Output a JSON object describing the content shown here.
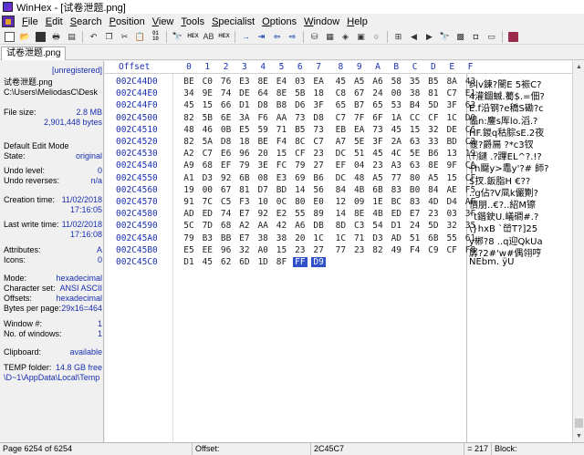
{
  "window": {
    "title": "WinHex - [试卷泄题.png]"
  },
  "menu": [
    {
      "label": "File",
      "ul": "F",
      "rest": "ile"
    },
    {
      "label": "Edit",
      "ul": "E",
      "rest": "dit"
    },
    {
      "label": "Search",
      "ul": "S",
      "rest": "earch"
    },
    {
      "label": "Position",
      "ul": "P",
      "rest": "osition"
    },
    {
      "label": "View",
      "ul": "V",
      "rest": "iew"
    },
    {
      "label": "Tools",
      "ul": "T",
      "rest": "ools"
    },
    {
      "label": "Specialist",
      "ul": "S",
      "rest": "pecialist"
    },
    {
      "label": "Options",
      "ul": "O",
      "rest": "ptions"
    },
    {
      "label": "Window",
      "ul": "W",
      "rest": "indow"
    },
    {
      "label": "Help",
      "ul": "H",
      "rest": "elp"
    }
  ],
  "toolbar": [
    "new-file-icon",
    "open-file-icon",
    "save-icon",
    "print-icon",
    "properties-icon",
    "sep",
    "undo-icon",
    "copy-block-icon",
    "cut-icon",
    "paste-icon",
    "fill-icon",
    "sep",
    "find-text-icon",
    "find-hex-icon",
    "replace-text-icon",
    "replace-hex-icon",
    "sep",
    "goto-offset-icon",
    "move-block-icon",
    "back-icon",
    "forward-icon",
    "sep",
    "disk-edit-icon",
    "ram-edit-icon",
    "disk-open-icon",
    "calculator-icon",
    "magnify-icon",
    "sep",
    "tile-icon",
    "nav-left-icon",
    "nav-right-icon",
    "bookmark-icon",
    "search-hash-icon",
    "camera-icon",
    "monitor-icon",
    "sep",
    "help-book-icon"
  ],
  "toolbar_tiny": {
    "hex_label": "HEX",
    "bin_label": "01\n10"
  },
  "tab": {
    "label": "试卷泄题.png"
  },
  "left_panel": {
    "registration": "[unregistered]",
    "file_name": "试卷泄题.png",
    "file_path": "C:\\Users\\MeliodasC\\Desk",
    "file_size_label": "File size:",
    "file_size_mb": "2.8 MB",
    "file_size_bytes": "2,901,448 bytes",
    "edit_mode": "Default Edit Mode",
    "state_label": "State:",
    "state_value": "original",
    "undo_level_label": "Undo level:",
    "undo_level_value": "0",
    "undo_reverses_label": "Undo reverses:",
    "undo_reverses_value": "n/a",
    "creation_time_label": "Creation time:",
    "creation_date": "11/02/2018",
    "creation_time": "17:16:05",
    "last_write_label": "Last write time:",
    "last_write_date": "11/02/2018",
    "last_write_time": "17:16:08",
    "attributes_label": "Attributes:",
    "attributes_value": "A",
    "icons_label": "Icons:",
    "icons_value": "0",
    "mode_label": "Mode:",
    "mode_value": "hexadecimal",
    "charset_label": "Character set:",
    "charset_value": "ANSI ASCII",
    "offsets_label": "Offsets:",
    "offsets_value": "hexadecimal",
    "bpp_label": "Bytes per page:",
    "bpp_value": "29x16=464",
    "window_num_label": "Window #:",
    "window_num_value": "1",
    "num_windows_label": "No. of windows:",
    "num_windows_value": "1",
    "clipboard_label": "Clipboard:",
    "clipboard_value": "available",
    "temp_label": "TEMP folder:",
    "temp_value": "14.8 GB free",
    "temp_path": "\\D~1\\AppData\\Local\\Temp"
  },
  "hex": {
    "header_offset": "Offset",
    "columns": [
      "0",
      "1",
      "2",
      "3",
      "4",
      "5",
      "6",
      "7",
      "8",
      "9",
      "A",
      "B",
      "C",
      "D",
      "E",
      "F"
    ],
    "rows": [
      {
        "offset": "002C44D0",
        "bytes": [
          "BE",
          "C0",
          "76",
          "E3",
          "8E",
          "E4",
          "03",
          "EA",
          "45",
          "A5",
          "A6",
          "58",
          "35",
          "B5",
          "8A",
          "43"
        ],
        "text": "纠v鍊?閿E  5裖C?"
      },
      {
        "offset": "002C44E0",
        "bytes": [
          "34",
          "9E",
          "74",
          "DE",
          "64",
          "8E",
          "5B",
          "18",
          "C8",
          "67",
          "24",
          "00",
          "38",
          "81",
          "C7",
          "E1"
        ],
        "text": "4灌錮蝛.薥$.=佃?"
      },
      {
        "offset": "002C44F0",
        "bytes": [
          "45",
          "15",
          "66",
          "D1",
          "D8",
          "B8",
          "D6",
          "3F",
          "65",
          "B7",
          "65",
          "53",
          "B4",
          "5D",
          "3F",
          "63"
        ],
        "text": "E.f沿钢?e穚S磡?c"
      },
      {
        "offset": "002C4500",
        "bytes": [
          "82",
          "5B",
          "6E",
          "3A",
          "F6",
          "AA",
          "73",
          "D8",
          "C7",
          "7F",
          "6F",
          "1A",
          "CC",
          "CF",
          "1C",
          "D0"
        ],
        "text": "偘n:鏖s厍lo.滔.?"
      },
      {
        "offset": "002C4510",
        "bytes": [
          "48",
          "46",
          "0B",
          "E5",
          "59",
          "71",
          "B5",
          "73",
          "EB",
          "EA",
          "73",
          "45",
          "15",
          "32",
          "DE",
          "C6"
        ],
        "text": "HF.鍐q秙腙sE.2夜"
      },
      {
        "offset": "002C4520",
        "bytes": [
          "82",
          "5A",
          "D8",
          "18",
          "BE",
          "F4",
          "8C",
          "C7",
          "A7",
          "5E",
          "3F",
          "2A",
          "63",
          "33",
          "BD",
          "C2"
        ],
        "text": "偃?爵屚  ?*c3钗"
      },
      {
        "offset": "002C4530",
        "bytes": [
          "A2",
          "C7",
          "E6",
          "96",
          "20",
          "15",
          "CF",
          "23",
          "DC",
          "51",
          "45",
          "4C",
          "5E",
          "B6",
          "13",
          "19"
        ],
        "text": "㈩鑓 .?蹕EL^?.!?"
      },
      {
        "offset": "002C4540",
        "bytes": [
          "A9",
          "68",
          "EF",
          "79",
          "3E",
          "FC",
          "79",
          "27",
          "EF",
          "04",
          "23",
          "A3",
          "63",
          "8E",
          "9F",
          "CA"
        ],
        "text": "┼h飋y>鼃y'?#  師?"
      },
      {
        "offset": "002C4550",
        "bytes": [
          "A1",
          "D3",
          "92",
          "6B",
          "08",
          "E3",
          "69",
          "B6",
          "DC",
          "48",
          "A5",
          "77",
          "80",
          "A5",
          "15",
          "CF"
        ],
        "text": "$扠.鈑脂H  €??"
      },
      {
        "offset": "002C4560",
        "bytes": [
          "19",
          "00",
          "67",
          "81",
          "D7",
          "BD",
          "14",
          "56",
          "84",
          "4B",
          "6B",
          "83",
          "B0",
          "84",
          "AE",
          "F5"
        ],
        "text": "..g佔?V凬k儼劗?"
      },
      {
        "offset": "002C4570",
        "bytes": [
          "91",
          "7C",
          "C5",
          "F3",
          "10",
          "0C",
          "80",
          "E0",
          "12",
          "09",
          "1E",
          "BC",
          "83",
          "4D",
          "D4",
          "AF"
        ],
        "text": "憒朋..€?..紹M镲"
      },
      {
        "offset": "002C4580",
        "bytes": [
          "AD",
          "ED",
          "74",
          "E7",
          "92",
          "E2",
          "55",
          "89",
          "14",
          "8E",
          "4B",
          "ED",
          "E7",
          "23",
          "03",
          "3F"
        ],
        "text": "`t鍇鉂U.嶬磵#.?"
      },
      {
        "offset": "002C4590",
        "bytes": [
          "5C",
          "7D",
          "68",
          "A2",
          "AA",
          "42",
          "A6",
          "DB",
          "8D",
          "C3",
          "54",
          "D1",
          "24",
          "5D",
          "32",
          "35"
        ],
        "text": "\\}hxB `嵤T?]25"
      },
      {
        "offset": "002C45A0",
        "bytes": [
          "79",
          "B3",
          "BB",
          "E7",
          "38",
          "38",
          "20",
          "1C",
          "1C",
          "71",
          "D3",
          "AD",
          "51",
          "6B",
          "55",
          "61"
        ],
        "text": "y郴?8 ..q迎QkUa"
      },
      {
        "offset": "002C45B0",
        "bytes": [
          "E5",
          "EE",
          "96",
          "32",
          "A0",
          "15",
          "23",
          "27",
          "77",
          "23",
          "82",
          "49",
          "F4",
          "C9",
          "CF",
          "F8"
        ],
        "text": "孱?2#'w#偶翎哼"
      },
      {
        "offset": "002C45C0",
        "bytes": [
          "D1",
          "45",
          "62",
          "6D",
          "1D",
          "8F",
          "FF",
          "D9"
        ],
        "text": "ÑEbm. ÿÙ"
      }
    ]
  },
  "status": {
    "page": "Page 6254 of 6254",
    "offset_label": "Offset:",
    "offset_value": "2C45C7",
    "selection": "= 217",
    "block_label": "Block:"
  }
}
